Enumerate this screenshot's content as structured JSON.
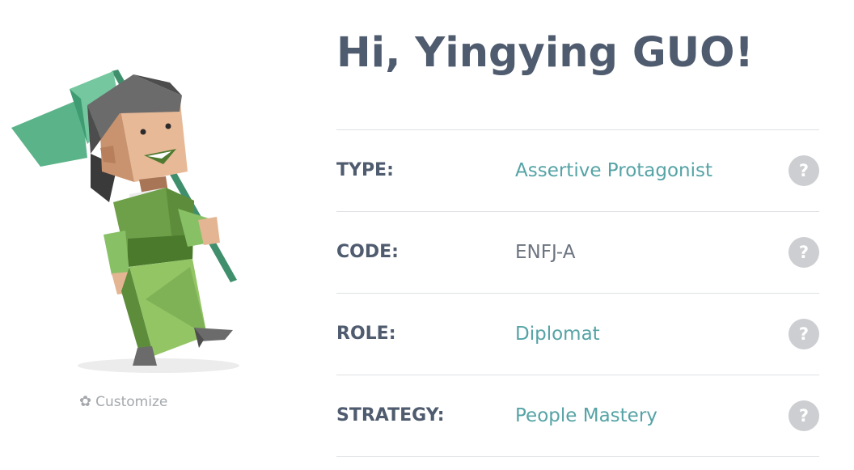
{
  "greeting": "Hi, Yingying GUO!",
  "customize": {
    "label": "Customize",
    "icon": "gear-icon"
  },
  "profile_rows": [
    {
      "label": "TYPE:",
      "value": "Assertive Protagonist",
      "value_color": "#56a3a6"
    },
    {
      "label": "CODE:",
      "value": "ENFJ-A",
      "value_color": "#6c7480"
    },
    {
      "label": "ROLE:",
      "value": "Diplomat",
      "value_color": "#56a3a6"
    },
    {
      "label": "STRATEGY:",
      "value": "People Mastery",
      "value_color": "#56a3a6"
    }
  ],
  "help_icon_label": "?",
  "colors": {
    "title": "#4f5b6e",
    "accent": "#56a3a6",
    "divider": "#dfe1e4",
    "help_bg": "#ccced1"
  }
}
